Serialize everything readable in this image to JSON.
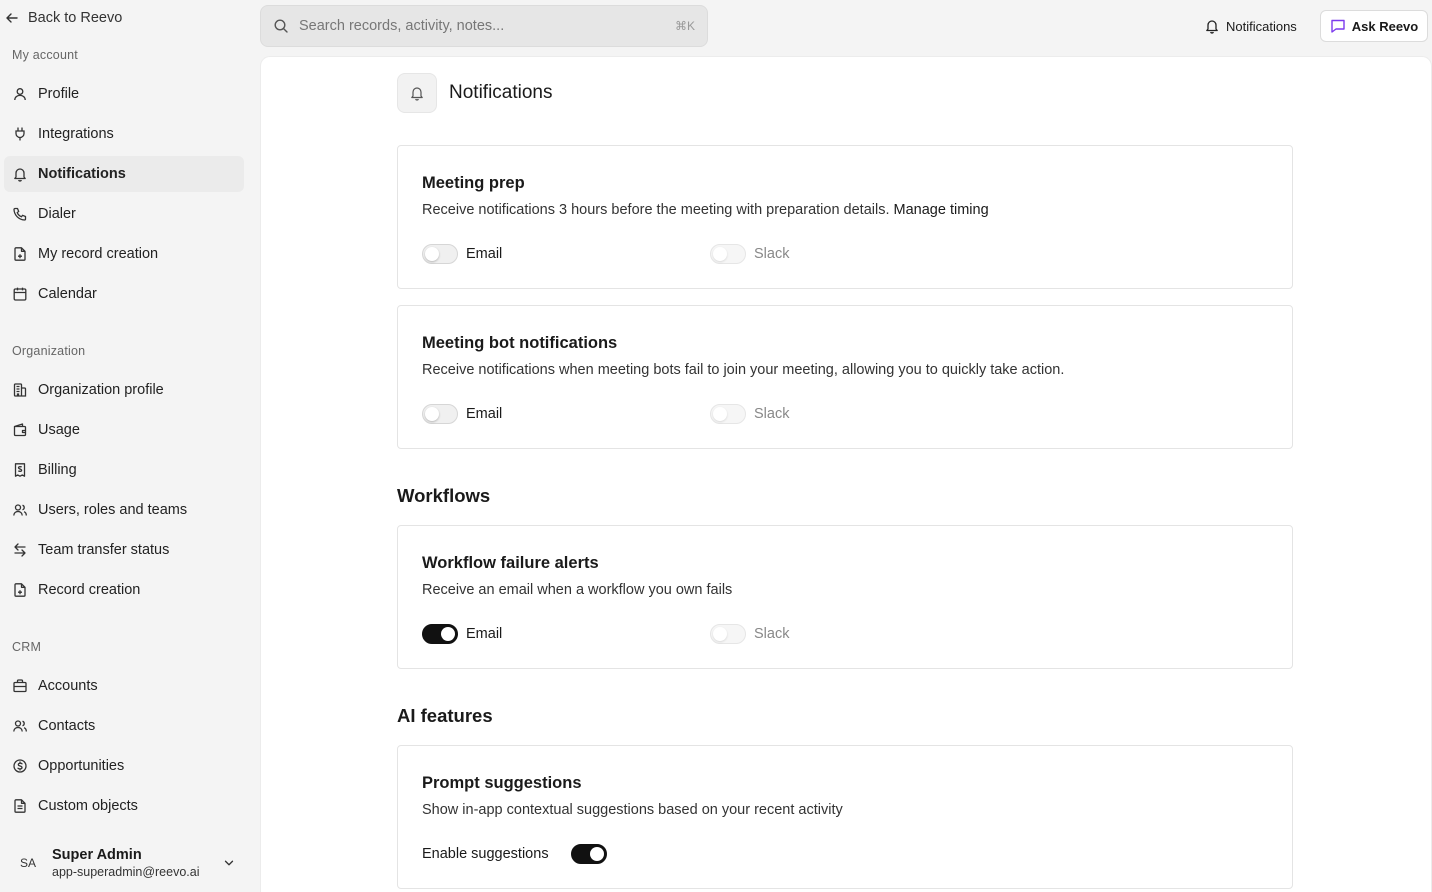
{
  "sidebar": {
    "back_label": "Back to Reevo",
    "sections": [
      {
        "title": "My account",
        "items": [
          {
            "label": "Profile",
            "icon": "user-icon"
          },
          {
            "label": "Integrations",
            "icon": "plug-icon"
          },
          {
            "label": "Notifications",
            "icon": "bell-icon",
            "active": true
          },
          {
            "label": "Dialer",
            "icon": "phone-icon"
          },
          {
            "label": "My record creation",
            "icon": "file-plus-icon"
          },
          {
            "label": "Calendar",
            "icon": "calendar-icon"
          }
        ]
      },
      {
        "title": "Organization",
        "items": [
          {
            "label": "Organization profile",
            "icon": "building-icon"
          },
          {
            "label": "Usage",
            "icon": "wallet-icon"
          },
          {
            "label": "Billing",
            "icon": "receipt-icon"
          },
          {
            "label": "Users, roles and teams",
            "icon": "users-icon"
          },
          {
            "label": "Team transfer status",
            "icon": "transfer-icon"
          },
          {
            "label": "Record creation",
            "icon": "file-plus-icon"
          }
        ]
      },
      {
        "title": "CRM",
        "items": [
          {
            "label": "Accounts",
            "icon": "briefcase-icon"
          },
          {
            "label": "Contacts",
            "icon": "users-icon"
          },
          {
            "label": "Opportunities",
            "icon": "dollar-circle-icon"
          },
          {
            "label": "Custom objects",
            "icon": "document-icon"
          }
        ]
      }
    ],
    "user": {
      "initials": "SA",
      "name": "Super Admin",
      "email": "app-superadmin@reevo.ai"
    }
  },
  "topbar": {
    "search_placeholder": "Search records, activity, notes...",
    "search_shortcut": "⌘K",
    "notifications_label": "Notifications",
    "ask_label": "Ask Reevo",
    "ask_icon_color": "#7c3aed"
  },
  "page": {
    "title": "Notifications",
    "cards": [
      {
        "title": "Meeting prep",
        "description": "Receive notifications 3 hours before the meeting with preparation details.",
        "link": "Manage timing",
        "email_label": "Email",
        "email_on": false,
        "slack_label": "Slack",
        "slack_disabled": true
      },
      {
        "title": "Meeting bot notifications",
        "description": "Receive notifications when meeting bots fail to join your meeting, allowing you to quickly take action.",
        "email_label": "Email",
        "email_on": false,
        "slack_label": "Slack",
        "slack_disabled": true
      }
    ],
    "workflows": {
      "heading": "Workflows",
      "card": {
        "title": "Workflow failure alerts",
        "description": "Receive an email when a workflow you own fails",
        "email_label": "Email",
        "email_on": true,
        "slack_label": "Slack",
        "slack_disabled": true
      }
    },
    "ai_features": {
      "heading": "AI features",
      "card": {
        "title": "Prompt suggestions",
        "description": "Show in-app contextual suggestions based on your recent activity",
        "toggle_label": "Enable suggestions",
        "toggle_on": true
      }
    }
  }
}
